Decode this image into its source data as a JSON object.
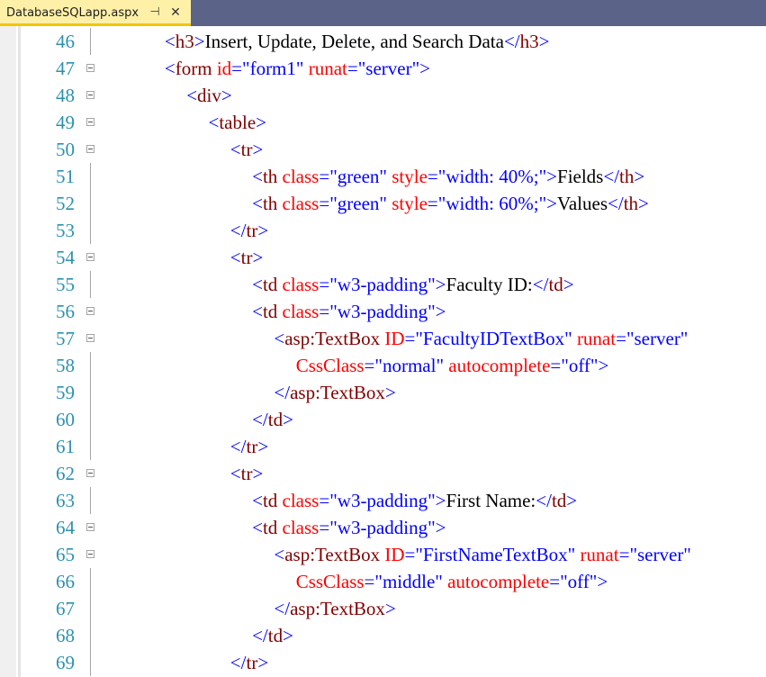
{
  "tab": {
    "title": "DatabaseSQLapp.aspx",
    "pin_glyph": "⊣",
    "close_glyph": "✕"
  },
  "colors": {
    "delimiter": "#0000ff",
    "tag": "#800000",
    "attribute": "#ff0000",
    "value": "#0000ff",
    "text": "#000000",
    "line_number": "#2b91af"
  },
  "lines": [
    {
      "n": "46",
      "indent": 3,
      "fold": "line",
      "tokens": [
        [
          "p",
          "<"
        ],
        [
          "d",
          "h3"
        ],
        [
          "p",
          ">"
        ],
        [
          "x",
          "Insert, Update, Delete, and Search Data"
        ],
        [
          "p",
          "</"
        ],
        [
          "d",
          "h3"
        ],
        [
          "p",
          ">"
        ]
      ]
    },
    {
      "n": "47",
      "indent": 3,
      "fold": "box",
      "tokens": [
        [
          "p",
          "<"
        ],
        [
          "d",
          "form "
        ],
        [
          "a",
          "id"
        ],
        [
          "p",
          "="
        ],
        [
          "v",
          "\"form1\" "
        ],
        [
          "a",
          "runat"
        ],
        [
          "p",
          "="
        ],
        [
          "v",
          "\"server\""
        ],
        [
          "p",
          ">"
        ]
      ]
    },
    {
      "n": "48",
      "indent": 4,
      "fold": "box",
      "tokens": [
        [
          "p",
          "<"
        ],
        [
          "d",
          "div"
        ],
        [
          "p",
          ">"
        ]
      ]
    },
    {
      "n": "49",
      "indent": 5,
      "fold": "box",
      "tokens": [
        [
          "p",
          "<"
        ],
        [
          "d",
          "table"
        ],
        [
          "p",
          ">"
        ]
      ]
    },
    {
      "n": "50",
      "indent": 6,
      "fold": "box",
      "tokens": [
        [
          "p",
          "<"
        ],
        [
          "d",
          "tr"
        ],
        [
          "p",
          ">"
        ]
      ]
    },
    {
      "n": "51",
      "indent": 7,
      "fold": "line",
      "tokens": [
        [
          "p",
          "<"
        ],
        [
          "d",
          "th "
        ],
        [
          "a",
          "class"
        ],
        [
          "p",
          "="
        ],
        [
          "v",
          "\"green\" "
        ],
        [
          "a",
          "style"
        ],
        [
          "p",
          "="
        ],
        [
          "v",
          "\"width"
        ],
        [
          "p",
          ": "
        ],
        [
          "v",
          "40%;\""
        ],
        [
          "p",
          ">"
        ],
        [
          "x",
          "Fields"
        ],
        [
          "p",
          "</"
        ],
        [
          "d",
          "th"
        ],
        [
          "p",
          ">"
        ]
      ]
    },
    {
      "n": "52",
      "indent": 7,
      "fold": "line",
      "tokens": [
        [
          "p",
          "<"
        ],
        [
          "d",
          "th "
        ],
        [
          "a",
          "class"
        ],
        [
          "p",
          "="
        ],
        [
          "v",
          "\"green\" "
        ],
        [
          "a",
          "style"
        ],
        [
          "p",
          "="
        ],
        [
          "v",
          "\"width"
        ],
        [
          "p",
          ": "
        ],
        [
          "v",
          "60%;\""
        ],
        [
          "p",
          ">"
        ],
        [
          "x",
          "Values"
        ],
        [
          "p",
          "</"
        ],
        [
          "d",
          "th"
        ],
        [
          "p",
          ">"
        ]
      ]
    },
    {
      "n": "53",
      "indent": 6,
      "fold": "line",
      "tokens": [
        [
          "p",
          "</"
        ],
        [
          "d",
          "tr"
        ],
        [
          "p",
          ">"
        ]
      ]
    },
    {
      "n": "54",
      "indent": 6,
      "fold": "box",
      "tokens": [
        [
          "p",
          "<"
        ],
        [
          "d",
          "tr"
        ],
        [
          "p",
          ">"
        ]
      ]
    },
    {
      "n": "55",
      "indent": 7,
      "fold": "line",
      "tokens": [
        [
          "p",
          "<"
        ],
        [
          "d",
          "td "
        ],
        [
          "a",
          "class"
        ],
        [
          "p",
          "="
        ],
        [
          "v",
          "\"w3-padding\""
        ],
        [
          "p",
          ">"
        ],
        [
          "x",
          "Faculty ID:"
        ],
        [
          "p",
          "</"
        ],
        [
          "d",
          "td"
        ],
        [
          "p",
          ">"
        ]
      ]
    },
    {
      "n": "56",
      "indent": 7,
      "fold": "box",
      "tokens": [
        [
          "p",
          "<"
        ],
        [
          "d",
          "td "
        ],
        [
          "a",
          "class"
        ],
        [
          "p",
          "="
        ],
        [
          "v",
          "\"w3-padding\""
        ],
        [
          "p",
          ">"
        ]
      ]
    },
    {
      "n": "57",
      "indent": 8,
      "fold": "box",
      "tokens": [
        [
          "p",
          "<"
        ],
        [
          "d",
          "asp:TextBox "
        ],
        [
          "a",
          "ID"
        ],
        [
          "p",
          "="
        ],
        [
          "v",
          "\"FacultyIDTextBox\" "
        ],
        [
          "a",
          "runat"
        ],
        [
          "p",
          "="
        ],
        [
          "v",
          "\"server\""
        ]
      ]
    },
    {
      "n": "58",
      "indent": 9,
      "fold": "line",
      "tokens": [
        [
          "a",
          "CssClass"
        ],
        [
          "p",
          "="
        ],
        [
          "v",
          "\"normal\" "
        ],
        [
          "a",
          "autocomplete"
        ],
        [
          "p",
          "="
        ],
        [
          "v",
          "\"off\""
        ],
        [
          "p",
          ">"
        ]
      ]
    },
    {
      "n": "59",
      "indent": 8,
      "fold": "line",
      "tokens": [
        [
          "p",
          "</"
        ],
        [
          "d",
          "asp:TextBox"
        ],
        [
          "p",
          ">"
        ]
      ]
    },
    {
      "n": "60",
      "indent": 7,
      "fold": "line",
      "tokens": [
        [
          "p",
          "</"
        ],
        [
          "d",
          "td"
        ],
        [
          "p",
          ">"
        ]
      ]
    },
    {
      "n": "61",
      "indent": 6,
      "fold": "line",
      "tokens": [
        [
          "p",
          "</"
        ],
        [
          "d",
          "tr"
        ],
        [
          "p",
          ">"
        ]
      ]
    },
    {
      "n": "62",
      "indent": 6,
      "fold": "box",
      "tokens": [
        [
          "p",
          "<"
        ],
        [
          "d",
          "tr"
        ],
        [
          "p",
          ">"
        ]
      ]
    },
    {
      "n": "63",
      "indent": 7,
      "fold": "line",
      "tokens": [
        [
          "p",
          "<"
        ],
        [
          "d",
          "td "
        ],
        [
          "a",
          "class"
        ],
        [
          "p",
          "="
        ],
        [
          "v",
          "\"w3-padding\""
        ],
        [
          "p",
          ">"
        ],
        [
          "x",
          "First Name:"
        ],
        [
          "p",
          "</"
        ],
        [
          "d",
          "td"
        ],
        [
          "p",
          ">"
        ]
      ]
    },
    {
      "n": "64",
      "indent": 7,
      "fold": "box",
      "tokens": [
        [
          "p",
          "<"
        ],
        [
          "d",
          "td "
        ],
        [
          "a",
          "class"
        ],
        [
          "p",
          "="
        ],
        [
          "v",
          "\"w3-padding\""
        ],
        [
          "p",
          ">"
        ]
      ]
    },
    {
      "n": "65",
      "indent": 8,
      "fold": "box",
      "tokens": [
        [
          "p",
          "<"
        ],
        [
          "d",
          "asp:TextBox "
        ],
        [
          "a",
          "ID"
        ],
        [
          "p",
          "="
        ],
        [
          "v",
          "\"FirstNameTextBox\" "
        ],
        [
          "a",
          "runat"
        ],
        [
          "p",
          "="
        ],
        [
          "v",
          "\"server\""
        ]
      ]
    },
    {
      "n": "66",
      "indent": 9,
      "fold": "line",
      "tokens": [
        [
          "a",
          "CssClass"
        ],
        [
          "p",
          "="
        ],
        [
          "v",
          "\"middle\" "
        ],
        [
          "a",
          "autocomplete"
        ],
        [
          "p",
          "="
        ],
        [
          "v",
          "\"off\""
        ],
        [
          "p",
          ">"
        ]
      ]
    },
    {
      "n": "67",
      "indent": 8,
      "fold": "line",
      "tokens": [
        [
          "p",
          "</"
        ],
        [
          "d",
          "asp:TextBox"
        ],
        [
          "p",
          ">"
        ]
      ]
    },
    {
      "n": "68",
      "indent": 7,
      "fold": "line",
      "tokens": [
        [
          "p",
          "</"
        ],
        [
          "d",
          "td"
        ],
        [
          "p",
          ">"
        ]
      ]
    },
    {
      "n": "69",
      "indent": 6,
      "fold": "line",
      "tokens": [
        [
          "p",
          "</"
        ],
        [
          "d",
          "tr"
        ],
        [
          "p",
          ">"
        ]
      ]
    }
  ]
}
